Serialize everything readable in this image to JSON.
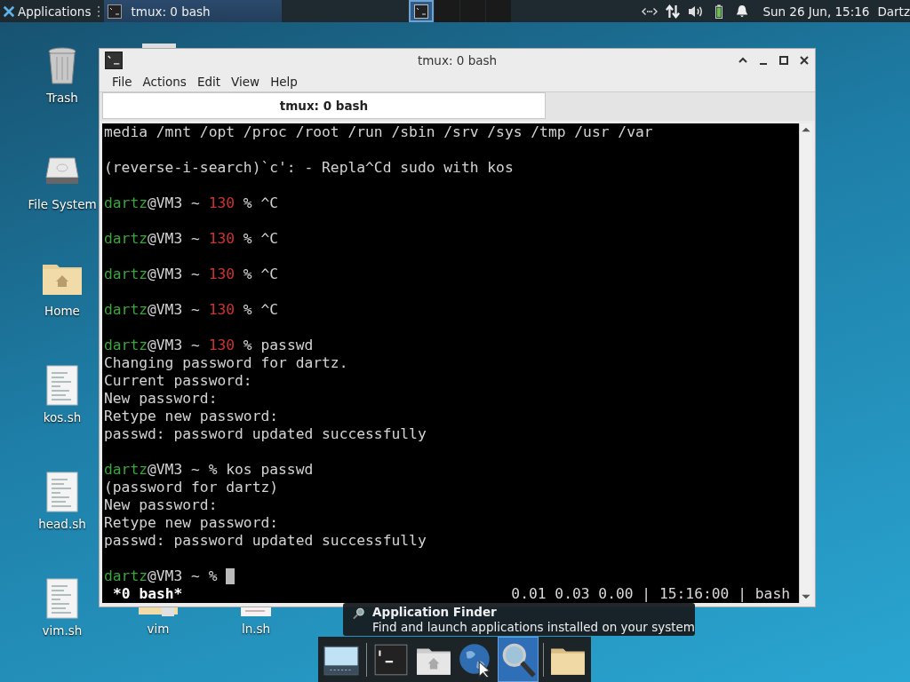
{
  "top_panel": {
    "app_menu": "Applications",
    "task": {
      "title": "tmux: 0 bash",
      "selected": true
    },
    "clock": "Sun 26 Jun, 15:16",
    "user": "Dartz"
  },
  "desktop_icons": [
    {
      "label": "Trash",
      "kind": "trash"
    },
    {
      "label": "File System",
      "kind": "drive"
    },
    {
      "label": "Home",
      "kind": "home"
    },
    {
      "label": "kos.sh",
      "kind": "script"
    },
    {
      "label": "head.sh",
      "kind": "script"
    },
    {
      "label": "vim.sh",
      "kind": "script"
    },
    {
      "label": "vim",
      "kind": "folder"
    },
    {
      "label": "ln.sh",
      "kind": "script"
    }
  ],
  "window": {
    "title": "tmux: 0 bash",
    "menu": [
      "File",
      "Actions",
      "Edit",
      "View",
      "Help"
    ],
    "tabs": [
      {
        "label": "tmux: 0 bash",
        "selected": true
      }
    ],
    "terminal": {
      "lines": [
        {
          "segments": [
            {
              "text": "media /mnt /opt /proc /root /run /sbin /srv /sys /tmp /usr /var",
              "kind": "plain"
            }
          ]
        },
        {
          "kind": "blank"
        },
        {
          "segments": [
            {
              "text": "(reverse-i-search)`c': - Repla^Cd sudo with kos",
              "kind": "plain"
            }
          ]
        },
        {
          "kind": "blank"
        },
        {
          "segments": [
            {
              "text": "dartz",
              "kind": "user"
            },
            {
              "text": "@VM3 ~ ",
              "kind": "plain"
            },
            {
              "text": "130",
              "kind": "code"
            },
            {
              "text": " % ^C",
              "kind": "plain"
            }
          ]
        },
        {
          "kind": "blank"
        },
        {
          "segments": [
            {
              "text": "dartz",
              "kind": "user"
            },
            {
              "text": "@VM3 ~ ",
              "kind": "plain"
            },
            {
              "text": "130",
              "kind": "code"
            },
            {
              "text": " % ^C",
              "kind": "plain"
            }
          ]
        },
        {
          "kind": "blank"
        },
        {
          "segments": [
            {
              "text": "dartz",
              "kind": "user"
            },
            {
              "text": "@VM3 ~ ",
              "kind": "plain"
            },
            {
              "text": "130",
              "kind": "code"
            },
            {
              "text": " % ^C",
              "kind": "plain"
            }
          ]
        },
        {
          "kind": "blank"
        },
        {
          "segments": [
            {
              "text": "dartz",
              "kind": "user"
            },
            {
              "text": "@VM3 ~ ",
              "kind": "plain"
            },
            {
              "text": "130",
              "kind": "code"
            },
            {
              "text": " % ^C",
              "kind": "plain"
            }
          ]
        },
        {
          "kind": "blank"
        },
        {
          "segments": [
            {
              "text": "dartz",
              "kind": "user"
            },
            {
              "text": "@VM3 ~ ",
              "kind": "plain"
            },
            {
              "text": "130",
              "kind": "code"
            },
            {
              "text": " % passwd",
              "kind": "plain"
            }
          ]
        },
        {
          "segments": [
            {
              "text": "Changing password for dartz.",
              "kind": "plain"
            }
          ]
        },
        {
          "segments": [
            {
              "text": "Current password:",
              "kind": "plain"
            }
          ]
        },
        {
          "segments": [
            {
              "text": "New password:",
              "kind": "plain"
            }
          ]
        },
        {
          "segments": [
            {
              "text": "Retype new password:",
              "kind": "plain"
            }
          ]
        },
        {
          "segments": [
            {
              "text": "passwd: password updated successfully",
              "kind": "plain"
            }
          ]
        },
        {
          "kind": "blank"
        },
        {
          "segments": [
            {
              "text": "dartz",
              "kind": "user"
            },
            {
              "text": "@VM3 ~ % kos passwd",
              "kind": "plain"
            }
          ]
        },
        {
          "segments": [
            {
              "text": "(password for dartz)",
              "kind": "plain"
            }
          ]
        },
        {
          "segments": [
            {
              "text": "New password:",
              "kind": "plain"
            }
          ]
        },
        {
          "segments": [
            {
              "text": "Retype new password:",
              "kind": "plain"
            }
          ]
        },
        {
          "segments": [
            {
              "text": "passwd: password updated successfully",
              "kind": "plain"
            }
          ]
        },
        {
          "kind": "blank"
        },
        {
          "cursor": true,
          "segments": [
            {
              "text": "dartz",
              "kind": "user"
            },
            {
              "text": "@VM3 ~ % ",
              "kind": "plain"
            }
          ]
        }
      ],
      "status_left": "*0 bash*",
      "status_right": "0.01 0.03 0.00 | 15:16:00 | bash"
    }
  },
  "tooltip": {
    "title": "Application Finder",
    "description": "Find and launch applications installed on your system"
  },
  "dock": [
    {
      "kind": "show-desktop",
      "selected": false
    },
    {
      "kind": "separator"
    },
    {
      "kind": "terminal",
      "selected": false
    },
    {
      "kind": "home-folder",
      "selected": false
    },
    {
      "kind": "browser",
      "selected": false
    },
    {
      "kind": "app-finder",
      "selected": true
    },
    {
      "kind": "separator"
    },
    {
      "kind": "folder",
      "selected": false
    }
  ]
}
